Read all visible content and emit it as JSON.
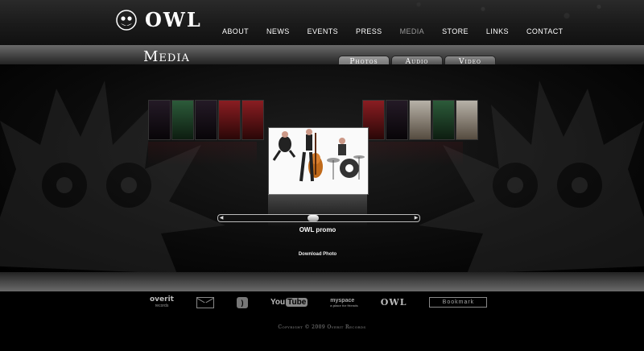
{
  "site": {
    "brand": "OWL"
  },
  "nav": [
    {
      "label": "ABOUT",
      "active": false
    },
    {
      "label": "NEWS",
      "active": false
    },
    {
      "label": "EVENTS",
      "active": false
    },
    {
      "label": "PRESS",
      "active": false
    },
    {
      "label": "MEDIA",
      "active": true
    },
    {
      "label": "STORE",
      "active": false
    },
    {
      "label": "LINKS",
      "active": false
    },
    {
      "label": "CONTACT",
      "active": false
    }
  ],
  "page": {
    "title": "Media"
  },
  "tabs": [
    {
      "label": "Photos",
      "active": true
    },
    {
      "label": "Audio",
      "active": false
    },
    {
      "label": "Video",
      "active": false
    }
  ],
  "gallery": {
    "caption": "OWL promo",
    "download_label": "Download Photo",
    "scroll_position": 0.47
  },
  "footer": {
    "overit_label": "overit",
    "overit_sub": "records",
    "youtube_label": "You",
    "youtube_tube": "Tube",
    "myspace_label": "myspace",
    "myspace_sub": "a place for friends",
    "owl_label": "OWL",
    "bookmark_label": "Bookmark",
    "copyright": "Copyright © 2009 Overit Records"
  },
  "colors": {
    "background": "#000000",
    "nav_active": "#9a9a9a"
  }
}
